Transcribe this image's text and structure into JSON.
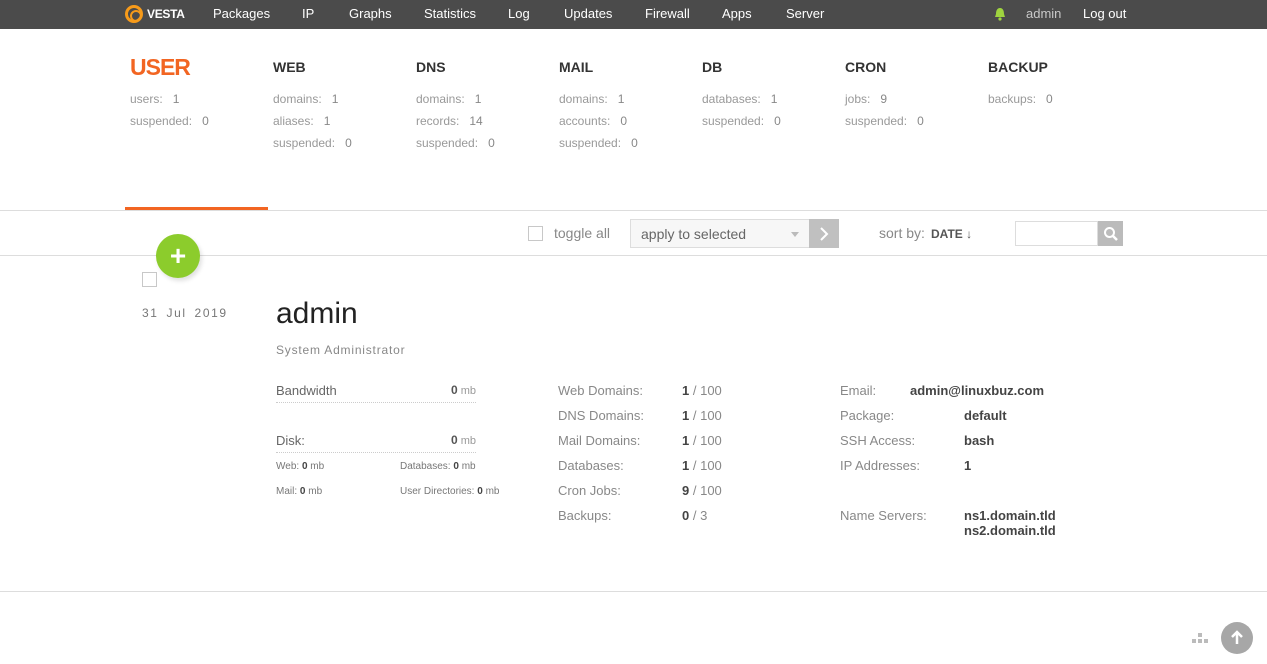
{
  "header": {
    "logo": "VESTA",
    "nav": [
      "Packages",
      "IP",
      "Graphs",
      "Statistics",
      "Log",
      "Updates",
      "Firewall",
      "Apps",
      "Server"
    ],
    "user": "admin",
    "logout": "Log out"
  },
  "stats": [
    {
      "title": "USER",
      "rows": [
        {
          "label": "users:",
          "value": "1"
        },
        {
          "label": "suspended:",
          "value": "0"
        }
      ]
    },
    {
      "title": "WEB",
      "rows": [
        {
          "label": "domains:",
          "value": "1"
        },
        {
          "label": "aliases:",
          "value": "1"
        },
        {
          "label": "suspended:",
          "value": "0"
        }
      ]
    },
    {
      "title": "DNS",
      "rows": [
        {
          "label": "domains:",
          "value": "1"
        },
        {
          "label": "records:",
          "value": "14"
        },
        {
          "label": "suspended:",
          "value": "0"
        }
      ]
    },
    {
      "title": "MAIL",
      "rows": [
        {
          "label": "domains:",
          "value": "1"
        },
        {
          "label": "accounts:",
          "value": "0"
        },
        {
          "label": "suspended:",
          "value": "0"
        }
      ]
    },
    {
      "title": "DB",
      "rows": [
        {
          "label": "databases:",
          "value": "1"
        },
        {
          "label": "suspended:",
          "value": "0"
        }
      ]
    },
    {
      "title": "CRON",
      "rows": [
        {
          "label": "jobs:",
          "value": "9"
        },
        {
          "label": "suspended:",
          "value": "0"
        }
      ]
    },
    {
      "title": "BACKUP",
      "rows": [
        {
          "label": "backups:",
          "value": "0"
        }
      ]
    }
  ],
  "toolbar": {
    "toggle_all": "toggle all",
    "apply_selected": "apply to selected",
    "sort_by": "sort by:",
    "sort_value": "DATE ↓",
    "search_placeholder": ""
  },
  "record": {
    "date": "31 Jul 2019",
    "name": "admin",
    "role": "System Administrator",
    "bandwidth": {
      "label": "Bandwidth",
      "value": "0",
      "unit": "mb"
    },
    "disk": {
      "label": "Disk:",
      "value": "0",
      "unit": "mb"
    },
    "disk_breakdown": [
      {
        "label": "Web:",
        "value": "0",
        "unit": "mb"
      },
      {
        "label": "Databases:",
        "value": "0",
        "unit": "mb"
      },
      {
        "label": "Mail:",
        "value": "0",
        "unit": "mb"
      },
      {
        "label": "User Directories:",
        "value": "0",
        "unit": "mb"
      }
    ],
    "quotas": [
      {
        "label": "Web Domains:",
        "used": "1",
        "limit": "/ 100"
      },
      {
        "label": "DNS Domains:",
        "used": "1",
        "limit": "/ 100"
      },
      {
        "label": "Mail Domains:",
        "used": "1",
        "limit": "/ 100"
      },
      {
        "label": "Databases:",
        "used": "1",
        "limit": "/ 100"
      },
      {
        "label": "Cron Jobs:",
        "used": "9",
        "limit": "/ 100"
      },
      {
        "label": "Backups:",
        "used": "0",
        "limit": "/ 3"
      }
    ],
    "info": [
      {
        "label": "Email:",
        "value": "admin@linuxbuz.com"
      },
      {
        "label": "Package:",
        "value": "default"
      },
      {
        "label": "SSH Access:",
        "value": "bash"
      },
      {
        "label": "IP Addresses:",
        "value": "1"
      }
    ],
    "name_servers": {
      "label": "Name Servers:",
      "values": [
        "ns1.domain.tld",
        "ns2.domain.tld"
      ]
    }
  },
  "colors": {
    "accent": "#f26522",
    "topbar": "#4b4b4b",
    "add_button": "#8ccc2c"
  },
  "icons": [
    "vesta-logo-icon",
    "bell-icon",
    "plus-icon",
    "chevron-right-icon",
    "search-icon",
    "grid-icon",
    "arrow-up-icon"
  ]
}
